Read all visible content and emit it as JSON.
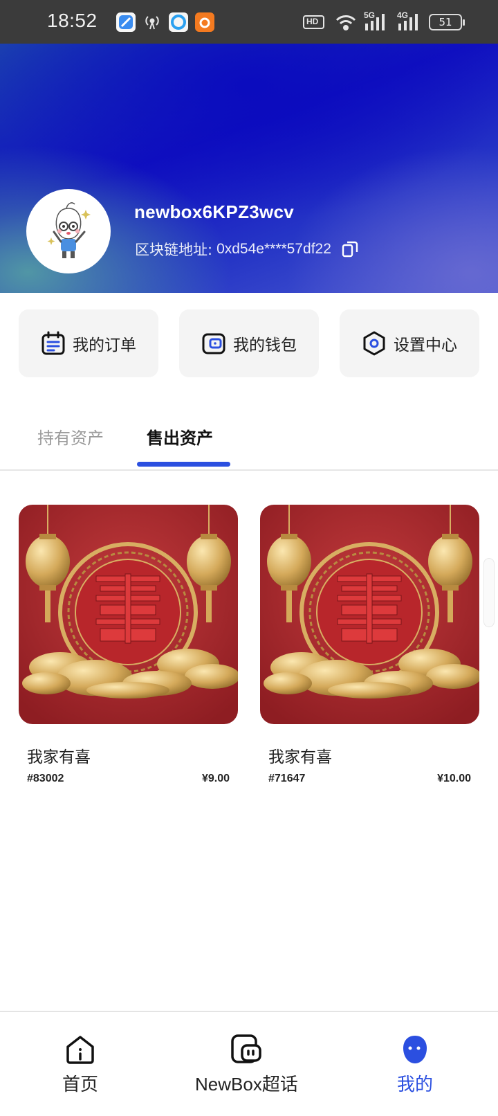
{
  "status_bar": {
    "time": "18:52",
    "network_hd": "HD",
    "network_5g": "5G",
    "network_4g": "4G",
    "battery": "51"
  },
  "profile": {
    "username": "newbox6KPZ3wcv",
    "address_label": "区块链地址:",
    "address_value": "0xd54e****57df22"
  },
  "actions": [
    {
      "label": "我的订单",
      "icon": "calendar-list-icon"
    },
    {
      "label": "我的钱包",
      "icon": "wallet-icon"
    },
    {
      "label": "设置中心",
      "icon": "hexagon-settings-icon"
    }
  ],
  "tabs": {
    "held": "持有资产",
    "sold": "售出资产",
    "active": "sold"
  },
  "assets": [
    {
      "name": "我家有喜",
      "id": "#83002",
      "price": "¥9.00"
    },
    {
      "name": "我家有喜",
      "id": "#71647",
      "price": "¥10.00"
    }
  ],
  "bottom_nav": [
    {
      "label": "首页",
      "icon": "home-icon"
    },
    {
      "label": "NewBox超话",
      "icon": "chat-icon"
    },
    {
      "label": "我的",
      "icon": "profile-icon",
      "active": true
    }
  ],
  "colors": {
    "accent": "#2b4fe0",
    "card_red": "#b3262c",
    "gold": "#d9b36a"
  }
}
